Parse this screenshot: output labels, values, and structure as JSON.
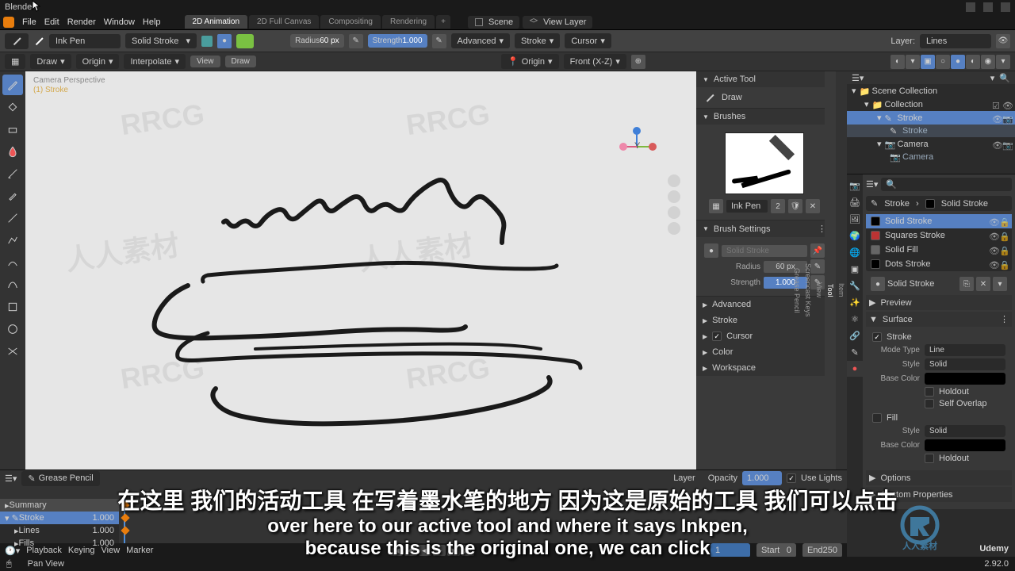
{
  "titlebar": {
    "app": "Blender"
  },
  "menu": {
    "items": [
      "File",
      "Edit",
      "Render",
      "Window",
      "Help"
    ]
  },
  "workspaces": {
    "active": "2D Animation",
    "others": [
      "2D Full Canvas",
      "Compositing",
      "Rendering"
    ],
    "plus": "+"
  },
  "scene": {
    "label": "Scene",
    "viewlayer": "View Layer"
  },
  "row2": {
    "mode": "Draw Mode",
    "brush_name": "Ink Pen",
    "material": "Solid Stroke",
    "radius_label": "Radius",
    "radius_val": "60 px",
    "strength_label": "Strength",
    "strength_val": "1.000",
    "advanced": "Advanced",
    "stroke": "Stroke",
    "cursor": "Cursor",
    "layer_label": "Layer:",
    "layer_val": "Lines"
  },
  "row3": {
    "draw": "Draw",
    "origin": "Origin",
    "interpolate": "Interpolate",
    "view": "View",
    "draw2": "Draw",
    "pivot": "Origin",
    "orient": "Front (X-Z)"
  },
  "viewport": {
    "persp": "Camera Perspective",
    "obj": "(1) Stroke"
  },
  "npanel": {
    "tabs": [
      "Item",
      "Tool",
      "View",
      "Screencast Keys",
      "Grease Pencil"
    ],
    "active_tool_hdr": "Active Tool",
    "active_tool_name": "Draw",
    "brushes_hdr": "Brushes",
    "brush_name": "Ink Pen",
    "brush_users": "2",
    "brush_settings_hdr": "Brush Settings",
    "brush_mat": "Solid Stroke",
    "radius_label": "Radius",
    "radius_val": "60 px",
    "strength_label": "Strength",
    "strength_val": "1.000",
    "sections": [
      "Advanced",
      "Stroke",
      "Cursor",
      "Color",
      "Workspace"
    ],
    "cursor_chk": "Cursor"
  },
  "outliner": {
    "scene_coll": "Scene Collection",
    "collection": "Collection",
    "stroke": "Stroke",
    "stroke_data": "Stroke",
    "camera": "Camera",
    "camera_data": "Camera"
  },
  "props": {
    "search_ph": "",
    "obj": "Stroke",
    "mat": "Solid Stroke",
    "mats": [
      "Solid Stroke",
      "Squares Stroke",
      "Solid Fill",
      "Dots Stroke"
    ],
    "mat_field": "Solid Stroke",
    "preview": "Preview",
    "surface": "Surface",
    "stroke_chk": "Stroke",
    "mode_type_l": "Mode Type",
    "mode_type_v": "Line",
    "style_l": "Style",
    "style_v": "Solid",
    "base_color_l": "Base Color",
    "holdout": "Holdout",
    "self_overlap": "Self Overlap",
    "fill": "Fill",
    "fill_style_l": "Style",
    "fill_style_v": "Solid",
    "fill_base_l": "Base Color",
    "fill_holdout": "Holdout",
    "options": "Options",
    "custom": "Custom Properties"
  },
  "timeline": {
    "hdr": "Grease Pencil",
    "summary": "Summary",
    "stroke": "Stroke",
    "lines": "Lines",
    "fills": "Fills",
    "val": "1.000",
    "playback": "Playback",
    "keying": "Keying",
    "view": "View",
    "marker": "Marker",
    "start_l": "Start",
    "start_v": "0",
    "end_l": "End",
    "end_v": "250",
    "cur": "1",
    "layer_l": "Layer",
    "opacity_l": "Opacity",
    "uselights": "Use Lights"
  },
  "status": {
    "mode": "Pan View",
    "version": "2.92.0"
  },
  "subs": {
    "cn": "在这里 我们的活动工具 在写着墨水笔的地方 因为这是原始的工具 我们可以点击",
    "en1": "over here to our active tool and where it says Inkpen,",
    "en2": "because this is the original one, we can click"
  },
  "udemy": "Udemy"
}
